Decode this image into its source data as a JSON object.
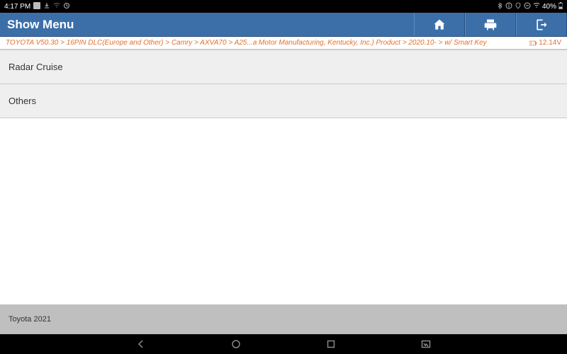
{
  "status": {
    "time": "4:17 PM",
    "battery": "40%"
  },
  "title": "Show Menu",
  "breadcrumb": "TOYOTA V50.30 > 16PIN DLC(Europe and Other) > Camry > AXVA70 > A25...a Motor Manufacturing, Kentucky, Inc.) Product > 2020.10- > w/ Smart Key",
  "voltage": "12.14V",
  "menu": {
    "items": [
      {
        "label": "Radar Cruise"
      },
      {
        "label": "Others"
      }
    ]
  },
  "footer": "Toyota  2021"
}
